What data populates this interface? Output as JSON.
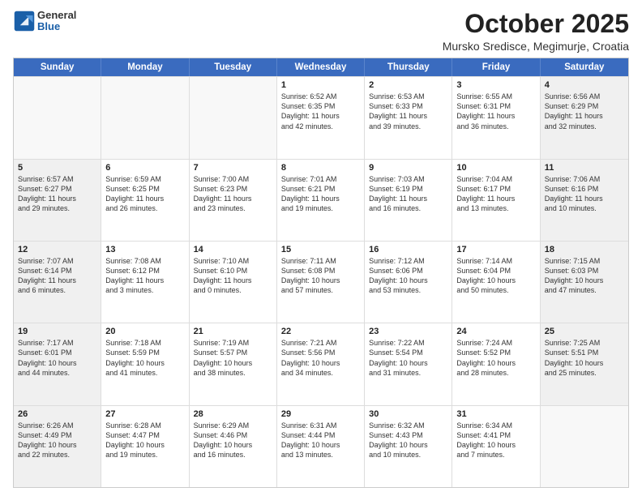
{
  "header": {
    "logo_general": "General",
    "logo_blue": "Blue",
    "title": "October 2025",
    "location": "Mursko Sredisce, Megimurje, Croatia"
  },
  "weekdays": [
    "Sunday",
    "Monday",
    "Tuesday",
    "Wednesday",
    "Thursday",
    "Friday",
    "Saturday"
  ],
  "rows": [
    [
      {
        "day": "",
        "lines": [],
        "empty": true
      },
      {
        "day": "",
        "lines": [],
        "empty": true
      },
      {
        "day": "",
        "lines": [],
        "empty": true
      },
      {
        "day": "1",
        "lines": [
          "Sunrise: 6:52 AM",
          "Sunset: 6:35 PM",
          "Daylight: 11 hours",
          "and 42 minutes."
        ],
        "empty": false
      },
      {
        "day": "2",
        "lines": [
          "Sunrise: 6:53 AM",
          "Sunset: 6:33 PM",
          "Daylight: 11 hours",
          "and 39 minutes."
        ],
        "empty": false
      },
      {
        "day": "3",
        "lines": [
          "Sunrise: 6:55 AM",
          "Sunset: 6:31 PM",
          "Daylight: 11 hours",
          "and 36 minutes."
        ],
        "empty": false
      },
      {
        "day": "4",
        "lines": [
          "Sunrise: 6:56 AM",
          "Sunset: 6:29 PM",
          "Daylight: 11 hours",
          "and 32 minutes."
        ],
        "empty": false,
        "shaded": true
      }
    ],
    [
      {
        "day": "5",
        "lines": [
          "Sunrise: 6:57 AM",
          "Sunset: 6:27 PM",
          "Daylight: 11 hours",
          "and 29 minutes."
        ],
        "empty": false,
        "shaded": true
      },
      {
        "day": "6",
        "lines": [
          "Sunrise: 6:59 AM",
          "Sunset: 6:25 PM",
          "Daylight: 11 hours",
          "and 26 minutes."
        ],
        "empty": false
      },
      {
        "day": "7",
        "lines": [
          "Sunrise: 7:00 AM",
          "Sunset: 6:23 PM",
          "Daylight: 11 hours",
          "and 23 minutes."
        ],
        "empty": false
      },
      {
        "day": "8",
        "lines": [
          "Sunrise: 7:01 AM",
          "Sunset: 6:21 PM",
          "Daylight: 11 hours",
          "and 19 minutes."
        ],
        "empty": false
      },
      {
        "day": "9",
        "lines": [
          "Sunrise: 7:03 AM",
          "Sunset: 6:19 PM",
          "Daylight: 11 hours",
          "and 16 minutes."
        ],
        "empty": false
      },
      {
        "day": "10",
        "lines": [
          "Sunrise: 7:04 AM",
          "Sunset: 6:17 PM",
          "Daylight: 11 hours",
          "and 13 minutes."
        ],
        "empty": false
      },
      {
        "day": "11",
        "lines": [
          "Sunrise: 7:06 AM",
          "Sunset: 6:16 PM",
          "Daylight: 11 hours",
          "and 10 minutes."
        ],
        "empty": false,
        "shaded": true
      }
    ],
    [
      {
        "day": "12",
        "lines": [
          "Sunrise: 7:07 AM",
          "Sunset: 6:14 PM",
          "Daylight: 11 hours",
          "and 6 minutes."
        ],
        "empty": false,
        "shaded": true
      },
      {
        "day": "13",
        "lines": [
          "Sunrise: 7:08 AM",
          "Sunset: 6:12 PM",
          "Daylight: 11 hours",
          "and 3 minutes."
        ],
        "empty": false
      },
      {
        "day": "14",
        "lines": [
          "Sunrise: 7:10 AM",
          "Sunset: 6:10 PM",
          "Daylight: 11 hours",
          "and 0 minutes."
        ],
        "empty": false
      },
      {
        "day": "15",
        "lines": [
          "Sunrise: 7:11 AM",
          "Sunset: 6:08 PM",
          "Daylight: 10 hours",
          "and 57 minutes."
        ],
        "empty": false
      },
      {
        "day": "16",
        "lines": [
          "Sunrise: 7:12 AM",
          "Sunset: 6:06 PM",
          "Daylight: 10 hours",
          "and 53 minutes."
        ],
        "empty": false
      },
      {
        "day": "17",
        "lines": [
          "Sunrise: 7:14 AM",
          "Sunset: 6:04 PM",
          "Daylight: 10 hours",
          "and 50 minutes."
        ],
        "empty": false
      },
      {
        "day": "18",
        "lines": [
          "Sunrise: 7:15 AM",
          "Sunset: 6:03 PM",
          "Daylight: 10 hours",
          "and 47 minutes."
        ],
        "empty": false,
        "shaded": true
      }
    ],
    [
      {
        "day": "19",
        "lines": [
          "Sunrise: 7:17 AM",
          "Sunset: 6:01 PM",
          "Daylight: 10 hours",
          "and 44 minutes."
        ],
        "empty": false,
        "shaded": true
      },
      {
        "day": "20",
        "lines": [
          "Sunrise: 7:18 AM",
          "Sunset: 5:59 PM",
          "Daylight: 10 hours",
          "and 41 minutes."
        ],
        "empty": false
      },
      {
        "day": "21",
        "lines": [
          "Sunrise: 7:19 AM",
          "Sunset: 5:57 PM",
          "Daylight: 10 hours",
          "and 38 minutes."
        ],
        "empty": false
      },
      {
        "day": "22",
        "lines": [
          "Sunrise: 7:21 AM",
          "Sunset: 5:56 PM",
          "Daylight: 10 hours",
          "and 34 minutes."
        ],
        "empty": false
      },
      {
        "day": "23",
        "lines": [
          "Sunrise: 7:22 AM",
          "Sunset: 5:54 PM",
          "Daylight: 10 hours",
          "and 31 minutes."
        ],
        "empty": false
      },
      {
        "day": "24",
        "lines": [
          "Sunrise: 7:24 AM",
          "Sunset: 5:52 PM",
          "Daylight: 10 hours",
          "and 28 minutes."
        ],
        "empty": false
      },
      {
        "day": "25",
        "lines": [
          "Sunrise: 7:25 AM",
          "Sunset: 5:51 PM",
          "Daylight: 10 hours",
          "and 25 minutes."
        ],
        "empty": false,
        "shaded": true
      }
    ],
    [
      {
        "day": "26",
        "lines": [
          "Sunrise: 6:26 AM",
          "Sunset: 4:49 PM",
          "Daylight: 10 hours",
          "and 22 minutes."
        ],
        "empty": false,
        "shaded": true
      },
      {
        "day": "27",
        "lines": [
          "Sunrise: 6:28 AM",
          "Sunset: 4:47 PM",
          "Daylight: 10 hours",
          "and 19 minutes."
        ],
        "empty": false
      },
      {
        "day": "28",
        "lines": [
          "Sunrise: 6:29 AM",
          "Sunset: 4:46 PM",
          "Daylight: 10 hours",
          "and 16 minutes."
        ],
        "empty": false
      },
      {
        "day": "29",
        "lines": [
          "Sunrise: 6:31 AM",
          "Sunset: 4:44 PM",
          "Daylight: 10 hours",
          "and 13 minutes."
        ],
        "empty": false
      },
      {
        "day": "30",
        "lines": [
          "Sunrise: 6:32 AM",
          "Sunset: 4:43 PM",
          "Daylight: 10 hours",
          "and 10 minutes."
        ],
        "empty": false
      },
      {
        "day": "31",
        "lines": [
          "Sunrise: 6:34 AM",
          "Sunset: 4:41 PM",
          "Daylight: 10 hours",
          "and 7 minutes."
        ],
        "empty": false
      },
      {
        "day": "",
        "lines": [],
        "empty": true,
        "shaded": true
      }
    ]
  ]
}
